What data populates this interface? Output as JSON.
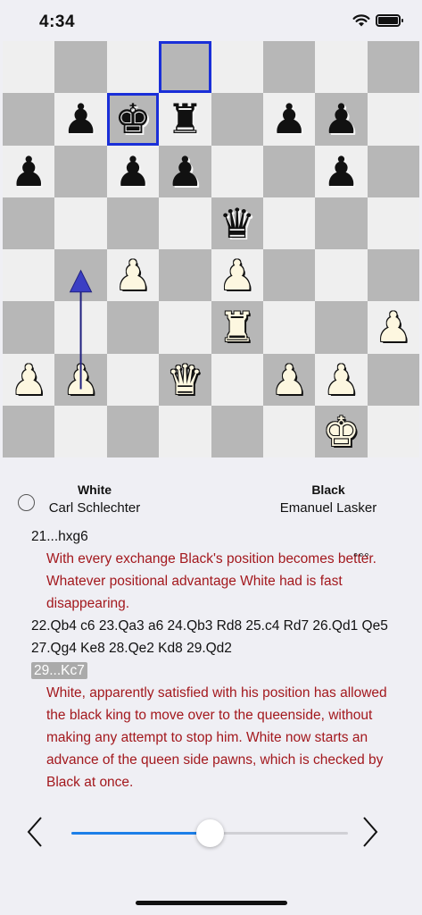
{
  "status_bar": {
    "time": "4:34",
    "wifi_icon": "wifi-icon",
    "battery_icon": "battery-icon"
  },
  "board": {
    "ranks": [
      [
        "",
        "",
        "",
        "",
        "",
        "",
        "",
        ""
      ],
      [
        "",
        "bp",
        "bk",
        "br",
        "",
        "bp",
        "bp",
        ""
      ],
      [
        "bp",
        "",
        "bp",
        "bp",
        "",
        "",
        "bp",
        ""
      ],
      [
        "",
        "",
        "",
        "",
        "bq",
        "",
        "",
        ""
      ],
      [
        "",
        "",
        "wp",
        "",
        "wp",
        "",
        "",
        ""
      ],
      [
        "",
        "",
        "",
        "",
        "wr",
        "",
        "",
        "wp"
      ],
      [
        "wp",
        "wp",
        "",
        "wq",
        "",
        "wp",
        "wp",
        ""
      ],
      [
        "",
        "",
        "",
        "",
        "",
        "",
        "wk",
        ""
      ]
    ],
    "highlight_squares": [
      "d8",
      "c7"
    ],
    "arrow": {
      "from": "b2",
      "to": "b4",
      "color": "#3b3fc4"
    }
  },
  "players": {
    "white_label": "White",
    "white_name": "Carl Schlechter",
    "black_label": "Black",
    "black_name": "Emanuel Lasker"
  },
  "notation": {
    "move1": "21...hxg6",
    "comment1": "With every exchange Black's position becomes better. Whatever positional advantage White had is fast disappearing.",
    "moves2": "22.Qb4 c6 23.Qa3 a6 24.Qb3 Rd8 25.c4 Rd7 26.Qd1 Qe5 27.Qg4 Ke8 28.Qe2 Kd8 29.Qd2",
    "current_move": "29...Kc7",
    "comment2": "White, apparently satisfied with his position has allowed the black king to move over to the queenside, without making any attempt to stop him. White now starts an advance of the queen side pawns, which is checked by Black at once.",
    "more_indicator": "°°°"
  },
  "controls": {
    "prev_icon": "chevron-left-icon",
    "next_icon": "chevron-right-icon",
    "slider_position": 0.5,
    "accent_color": "#1c7fe8"
  }
}
